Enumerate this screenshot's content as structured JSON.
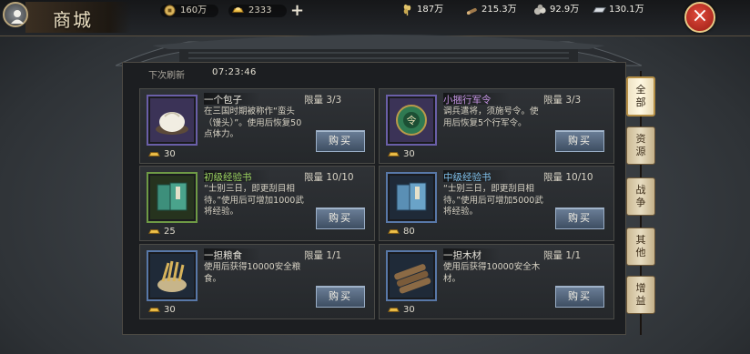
{
  "title": "商城",
  "currencies": [
    {
      "icon": "silver-coin-icon",
      "value": "160万"
    },
    {
      "icon": "gold-ingot-icon",
      "value": "2333"
    }
  ],
  "plus_label": "+",
  "resources": [
    {
      "icon": "wheat-icon",
      "value": "187万"
    },
    {
      "icon": "wood-icon",
      "value": "215.3万"
    },
    {
      "icon": "stone-icon",
      "value": "92.9万"
    },
    {
      "icon": "iron-icon",
      "value": "130.1万"
    }
  ],
  "close_label": "×",
  "refresh": {
    "label": "下次刷新",
    "time": "07:23:46"
  },
  "items": [
    {
      "name": "一个包子",
      "rarity": "white",
      "limit": "限量 3/3",
      "desc": "在三国时期被称作“蛮头（馒头）”。使用后恢复50点体力。",
      "buy": "购买",
      "price": "30",
      "icon": "bun-icon"
    },
    {
      "name": "小捆行军令",
      "rarity": "purple",
      "limit": "限量 3/3",
      "desc": "调兵遣将，须施号令。使用后恢复5个行军令。",
      "buy": "购买",
      "price": "30",
      "icon": "military-token-icon"
    },
    {
      "name": "初级经验书",
      "rarity": "green",
      "limit": "限量 10/10",
      "desc": "“士别三日，即更刮目相待。”使用后可增加1000武将经验。",
      "buy": "购买",
      "price": "25",
      "icon": "green-book-icon"
    },
    {
      "name": "中级经验书",
      "rarity": "blue",
      "limit": "限量 10/10",
      "desc": "“士别三日，即更刮目相待。”使用后可增加5000武将经验。",
      "buy": "购买",
      "price": "80",
      "icon": "blue-book-icon"
    },
    {
      "name": "一担粮食",
      "rarity": "white",
      "limit": "限量 1/1",
      "desc": "使用后获得10000安全粮食。",
      "buy": "购买",
      "price": "30",
      "icon": "grain-sack-icon"
    },
    {
      "name": "一担木材",
      "rarity": "white",
      "limit": "限量 1/1",
      "desc": "使用后获得10000安全木材。",
      "buy": "购买",
      "price": "30",
      "icon": "timber-icon"
    }
  ],
  "tabs": [
    "全部",
    "资源",
    "战争",
    "其他",
    "增益"
  ],
  "active_tab": "全部"
}
